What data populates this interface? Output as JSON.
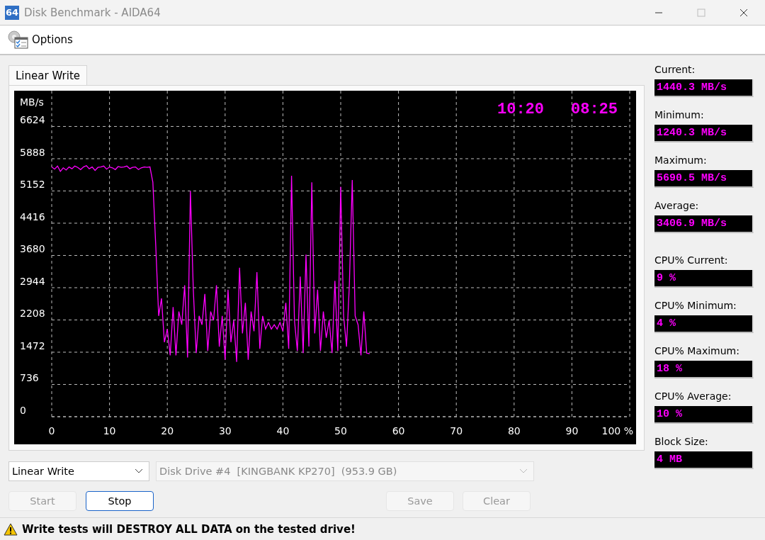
{
  "window": {
    "title": "Disk Benchmark - AIDA64",
    "app_icon": "64"
  },
  "toolbar": {
    "options_label": "Options"
  },
  "tabs": [
    {
      "label": "Linear Write",
      "selected": true
    }
  ],
  "graph": {
    "timers": [
      "10:20",
      "08:25"
    ],
    "chart_data": {
      "type": "line",
      "ylabel": "MB/s",
      "grid": true,
      "xlim": [
        0,
        100
      ],
      "ylim": [
        0,
        7440
      ],
      "xticks": [
        0,
        10,
        20,
        30,
        40,
        50,
        60,
        70,
        80,
        90,
        {
          "value": 100,
          "label": "100 %"
        }
      ],
      "yticks": [
        0,
        736,
        1472,
        2208,
        2944,
        3680,
        4416,
        5152,
        5888,
        6624
      ],
      "x": [
        0,
        0.5,
        1,
        1.5,
        2,
        2.5,
        3,
        3.5,
        4,
        4.5,
        5,
        5.5,
        6,
        6.5,
        7,
        7.5,
        8,
        8.5,
        9,
        9.5,
        10,
        10.5,
        11,
        11.5,
        12,
        12.5,
        13,
        13.5,
        14,
        14.5,
        15,
        15.5,
        16,
        16.5,
        17,
        17.5,
        18,
        18.5,
        19,
        19.5,
        20,
        20.5,
        21,
        21.5,
        22,
        22.5,
        23,
        23.5,
        24,
        24.5,
        25,
        25.5,
        26,
        26.5,
        27,
        27.5,
        28,
        28.5,
        29,
        29.5,
        30,
        30.5,
        31,
        31.5,
        32,
        32.5,
        33,
        33.5,
        34,
        34.5,
        35,
        35.5,
        36,
        36.5,
        37,
        37.5,
        38,
        38.5,
        39,
        39.5,
        40,
        40.5,
        41,
        41.5,
        42,
        42.5,
        43,
        43.5,
        44,
        44.5,
        45,
        45.5,
        46,
        46.5,
        47,
        47.5,
        48,
        48.5,
        49,
        49.5,
        50,
        50.5,
        51,
        51.5,
        52,
        52.5,
        53,
        53.5,
        54,
        54.5,
        55
      ],
      "series": [
        {
          "color": "#ff00ff",
          "values": [
            5700,
            5650,
            5720,
            5600,
            5680,
            5630,
            5700,
            5660,
            5720,
            5690,
            5640,
            5700,
            5730,
            5660,
            5700,
            5620,
            5690,
            5700,
            5720,
            5650,
            5700,
            5680,
            5640,
            5710,
            5690,
            5700,
            5720,
            5660,
            5690,
            5700,
            5640,
            5680,
            5700,
            5690,
            5700,
            5350,
            3900,
            2300,
            2700,
            1700,
            2000,
            1400,
            2500,
            1400,
            2400,
            2100,
            3000,
            1350,
            5150,
            2900,
            1450,
            2300,
            2100,
            2800,
            1500,
            2400,
            2200,
            3000,
            1600,
            2300,
            1300,
            2900,
            1700,
            2200,
            1250,
            3400,
            1900,
            2600,
            1300,
            2400,
            1950,
            3300,
            1550,
            2300,
            2000,
            2150,
            2000,
            2100,
            2000,
            2150,
            1950,
            2600,
            1550,
            5500,
            2200,
            1500,
            3200,
            1450,
            3700,
            1600,
            5350,
            1900,
            2900,
            1500,
            2400,
            1800,
            2200,
            1450,
            3100,
            1500,
            5250,
            2300,
            1600,
            3000,
            5400,
            2300,
            2100,
            1400,
            2400,
            1450,
            1440
          ]
        }
      ]
    }
  },
  "stats": [
    {
      "label": "Current:",
      "value": "1440.3 MB/s"
    },
    {
      "label": "Minimum:",
      "value": "1240.3 MB/s"
    },
    {
      "label": "Maximum:",
      "value": "5690.5 MB/s"
    },
    {
      "label": "Average:",
      "value": "3406.9 MB/s"
    },
    {
      "label": "CPU% Current:",
      "value": "9 %"
    },
    {
      "label": "CPU% Minimum:",
      "value": "4 %"
    },
    {
      "label": "CPU% Maximum:",
      "value": "18 %"
    },
    {
      "label": "CPU% Average:",
      "value": "10 %"
    },
    {
      "label": "Block Size:",
      "value": "4 MB"
    }
  ],
  "selectors": [
    {
      "value": "Linear Write",
      "disabled": false
    },
    {
      "value": "Disk Drive #4  [KINGBANK KP270]  (953.9 GB)",
      "disabled": true
    }
  ],
  "buttons": [
    {
      "label": "Start",
      "disabled": true,
      "focused": false
    },
    {
      "label": "Stop",
      "disabled": false,
      "focused": true
    },
    {
      "label": "Save",
      "disabled": true,
      "focused": false
    },
    {
      "label": "Clear",
      "disabled": true,
      "focused": false
    }
  ],
  "status_bar": {
    "warning": "Write tests will DESTROY ALL DATA on the tested drive!"
  }
}
